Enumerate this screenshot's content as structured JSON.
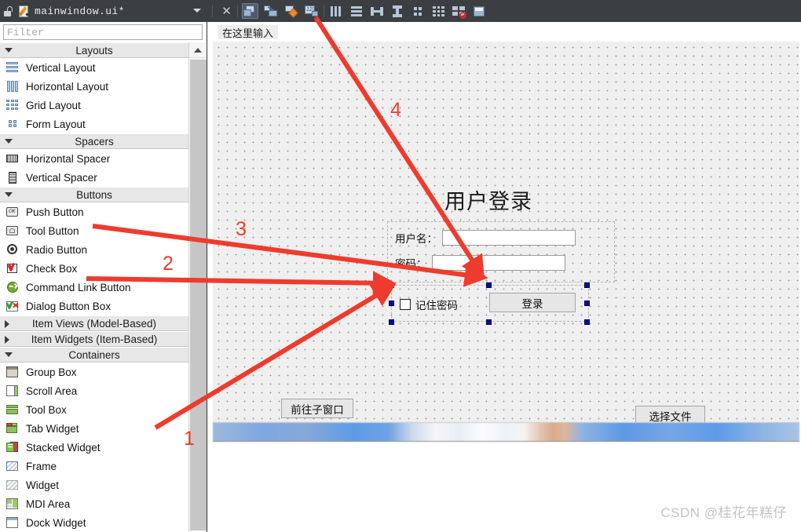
{
  "window": {
    "document_title": "mainwindow.ui*",
    "lock_icon": "unlocked-padlock-icon",
    "doc_icon": "ui-file-icon",
    "dropdown_icon": "chevron-down-icon"
  },
  "toolbar": {
    "buttons": [
      {
        "name": "close-form",
        "icon": "close-x-icon",
        "label": "X",
        "selected": false
      },
      {
        "name": "edit-widgets",
        "icon": "edit-widgets-icon",
        "label": "",
        "selected": true
      },
      {
        "name": "edit-signals-slots",
        "icon": "signals-slots-icon",
        "label": "",
        "selected": false
      },
      {
        "name": "edit-buddies",
        "icon": "buddies-icon",
        "label": "",
        "selected": false
      },
      {
        "name": "edit-tab-order",
        "icon": "tab-order-icon",
        "label": "",
        "selected": false
      },
      {
        "name": "lay-out-horizontally",
        "icon": "layout-horizontal-icon",
        "label": "",
        "selected": false
      },
      {
        "name": "lay-out-vertically",
        "icon": "layout-vertical-icon",
        "label": "",
        "selected": false
      },
      {
        "name": "lay-out-horizontally-in-splitter",
        "icon": "splitter-horizontal-icon",
        "label": "",
        "selected": false
      },
      {
        "name": "lay-out-vertically-in-splitter",
        "icon": "splitter-vertical-icon",
        "label": "",
        "selected": false
      },
      {
        "name": "lay-out-in-form-layout",
        "icon": "form-layout-icon",
        "label": "",
        "selected": false
      },
      {
        "name": "lay-out-in-grid",
        "icon": "grid-layout-icon",
        "label": "",
        "selected": false
      },
      {
        "name": "break-layout",
        "icon": "break-layout-icon",
        "label": "",
        "selected": false
      },
      {
        "name": "adjust-size",
        "icon": "adjust-size-icon",
        "label": "",
        "selected": false
      }
    ]
  },
  "filter": {
    "placeholder": "Filter",
    "value": ""
  },
  "widget_box": {
    "groups": [
      {
        "name": "layouts",
        "label": "Layouts",
        "expanded": true,
        "items": [
          {
            "label": "Vertical Layout",
            "icon": "vertical-layout-icon"
          },
          {
            "label": "Horizontal Layout",
            "icon": "horizontal-layout-icon"
          },
          {
            "label": "Grid Layout",
            "icon": "grid-layout-icon"
          },
          {
            "label": "Form Layout",
            "icon": "form-layout-icon"
          }
        ]
      },
      {
        "name": "spacers",
        "label": "Spacers",
        "expanded": true,
        "items": [
          {
            "label": "Horizontal Spacer",
            "icon": "horizontal-spacer-icon"
          },
          {
            "label": "Vertical Spacer",
            "icon": "vertical-spacer-icon"
          }
        ]
      },
      {
        "name": "buttons",
        "label": "Buttons",
        "expanded": true,
        "items": [
          {
            "label": "Push Button",
            "icon": "push-button-icon"
          },
          {
            "label": "Tool Button",
            "icon": "tool-button-icon"
          },
          {
            "label": "Radio Button",
            "icon": "radio-button-icon"
          },
          {
            "label": "Check Box",
            "icon": "check-box-icon"
          },
          {
            "label": "Command Link Button",
            "icon": "command-link-icon"
          },
          {
            "label": "Dialog Button Box",
            "icon": "dialog-button-box-icon"
          }
        ]
      },
      {
        "name": "item-views",
        "label": "Item Views (Model-Based)",
        "expanded": false,
        "items": []
      },
      {
        "name": "item-widgets",
        "label": "Item Widgets (Item-Based)",
        "expanded": false,
        "items": []
      },
      {
        "name": "containers",
        "label": "Containers",
        "expanded": true,
        "items": [
          {
            "label": "Group Box",
            "icon": "group-box-icon"
          },
          {
            "label": "Scroll Area",
            "icon": "scroll-area-icon"
          },
          {
            "label": "Tool Box",
            "icon": "tool-box-icon"
          },
          {
            "label": "Tab Widget",
            "icon": "tab-widget-icon"
          },
          {
            "label": "Stacked Widget",
            "icon": "stacked-widget-icon"
          },
          {
            "label": "Frame",
            "icon": "frame-icon"
          },
          {
            "label": "Widget",
            "icon": "widget-icon"
          },
          {
            "label": "MDI Area",
            "icon": "mdi-area-icon"
          },
          {
            "label": "Dock Widget",
            "icon": "dock-widget-icon"
          }
        ]
      }
    ]
  },
  "form": {
    "menubar_placeholder": "在这里输入",
    "title": "用户登录",
    "fields": [
      {
        "label": "用户名：",
        "value": "",
        "name": "username"
      },
      {
        "label": "密码：",
        "value": "",
        "name": "password"
      }
    ],
    "remember_label": "记住密码",
    "remember_checked": false,
    "login_button": "登录",
    "subwindow_button": "前往子窗口",
    "choose_file_button": "选择文件"
  },
  "annotations": {
    "numbers": [
      "1",
      "2",
      "3",
      "4"
    ],
    "color": "#ef3b2d"
  },
  "watermark": "CSDN @桂花年糕仔"
}
